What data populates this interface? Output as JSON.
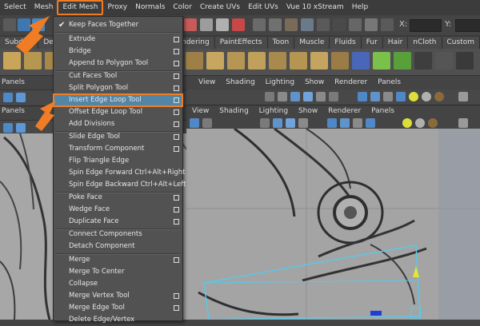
{
  "menubar": {
    "items": [
      "Select",
      "Mesh",
      "Edit Mesh",
      "Proxy",
      "Normals",
      "Color",
      "Create UVs",
      "Edit UVs",
      "Vue 10 xStream",
      "Help"
    ],
    "highlighted": "Edit Mesh",
    "highlight_color": "#f07d26"
  },
  "toolbar": {
    "x_label": "X:",
    "y_label": "Y:"
  },
  "shelf_tabs": [
    "Subdivs",
    "Defo",
    "endering",
    "PaintEffects",
    "Toon",
    "Muscle",
    "Fluids",
    "Fur",
    "Hair",
    "nCloth",
    "Custom"
  ],
  "left_panel": {
    "label_top": "Panels",
    "label_bottom": "Panels"
  },
  "viewport_top": {
    "menu": [
      "View",
      "Shading",
      "Lighting",
      "Show",
      "Renderer",
      "Panels"
    ]
  },
  "viewport_main": {
    "menu": [
      "View",
      "Shading",
      "Lighting",
      "Show",
      "Renderer",
      "Panels"
    ]
  },
  "dropdown": {
    "items": [
      {
        "label": "Keep Faces Together",
        "checked": true,
        "option_box": false
      },
      {
        "label": "Extrude",
        "option_box": true
      },
      {
        "label": "Bridge",
        "option_box": true
      },
      {
        "label": "Append to Polygon Tool",
        "option_box": true
      },
      {
        "label": "Cut Faces Tool",
        "option_box": true
      },
      {
        "label": "Split Polygon Tool",
        "option_box": true
      },
      {
        "label": "Insert Edge Loop Tool",
        "option_box": true,
        "highlighted": true
      },
      {
        "label": "Offset Edge Loop Tool",
        "option_box": true
      },
      {
        "label": "Add Divisions",
        "option_box": true
      },
      {
        "label": "Slide Edge Tool",
        "option_box": true
      },
      {
        "label": "Transform Component",
        "option_box": true
      },
      {
        "label": "Flip Triangle Edge",
        "option_box": false
      },
      {
        "label": "Spin Edge Forward  Ctrl+Alt+Right",
        "option_box": false
      },
      {
        "label": "Spin Edge Backward  Ctrl+Alt+Left",
        "option_box": false
      },
      {
        "label": "Poke Face",
        "option_box": true
      },
      {
        "label": "Wedge Face",
        "option_box": true
      },
      {
        "label": "Duplicate Face",
        "option_box": true
      },
      {
        "label": "Connect Components",
        "option_box": false
      },
      {
        "label": "Detach Component",
        "option_box": false
      },
      {
        "label": "Merge",
        "option_box": true
      },
      {
        "label": "Merge To Center",
        "option_box": false
      },
      {
        "label": "Collapse",
        "option_box": false
      },
      {
        "label": "Merge Vertex Tool",
        "option_box": true
      },
      {
        "label": "Merge Edge Tool",
        "option_box": true
      },
      {
        "label": "Delete Edge/Vertex",
        "option_box": false
      }
    ]
  },
  "colors": {
    "accent_orange": "#f07d26",
    "menu_highlight": "#5285a6",
    "wireframe": "#5cc7e6"
  }
}
